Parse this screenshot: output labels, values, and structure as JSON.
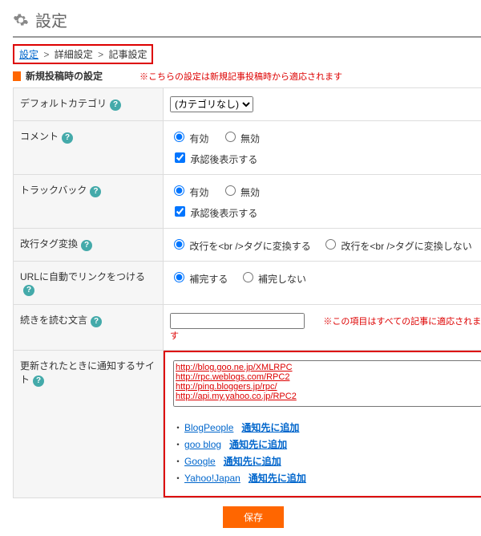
{
  "header": {
    "title": "設定",
    "gear_icon": "gear-icon"
  },
  "breadcrumb": {
    "items": [
      "設定",
      "詳細設定",
      "記事設定"
    ],
    "sep": ">"
  },
  "section": {
    "title": "新規投稿時の設定",
    "note": "※こちらの設定は新規記事投稿時から適応されます"
  },
  "rows": {
    "category": {
      "label": "デフォルトカテゴリ",
      "help": "?",
      "select_value": "(カテゴリなし)"
    },
    "comment": {
      "label": "コメント",
      "opt1": "有効",
      "opt2": "無効",
      "chk": "承認後表示する"
    },
    "trackback": {
      "label": "トラックバック",
      "opt1": "有効",
      "opt2": "無効",
      "chk": "承認後表示する"
    },
    "br": {
      "label": "改行タグ変換",
      "opt1": "改行を<br />タグに変換する",
      "opt2": "改行を<br />タグに変換しない"
    },
    "autolink": {
      "label": "URLに自動でリンクをつける",
      "opt1": "補完する",
      "opt2": "補完しない"
    },
    "readmore": {
      "label": "続きを読む文言",
      "value": "",
      "note": "※この項目はすべての記事に適応されます"
    },
    "ping": {
      "label": "更新されたときに通知するサイト",
      "textarea": "http://blog.goo.ne.jp/XMLRPC\nhttp://rpc.weblogs.com/RPC2\nhttp://ping.bloggers.jp/rpc/\nhttp://api.my.yahoo.co.jp/RPC2",
      "services": [
        {
          "name": "BlogPeople",
          "action": "通知先に追加"
        },
        {
          "name": "goo blog",
          "action": "通知先に追加"
        },
        {
          "name": "Google",
          "action": "通知先に追加"
        },
        {
          "name": "Yahoo!Japan",
          "action": "通知先に追加"
        }
      ]
    }
  },
  "save": {
    "label": "保存"
  }
}
